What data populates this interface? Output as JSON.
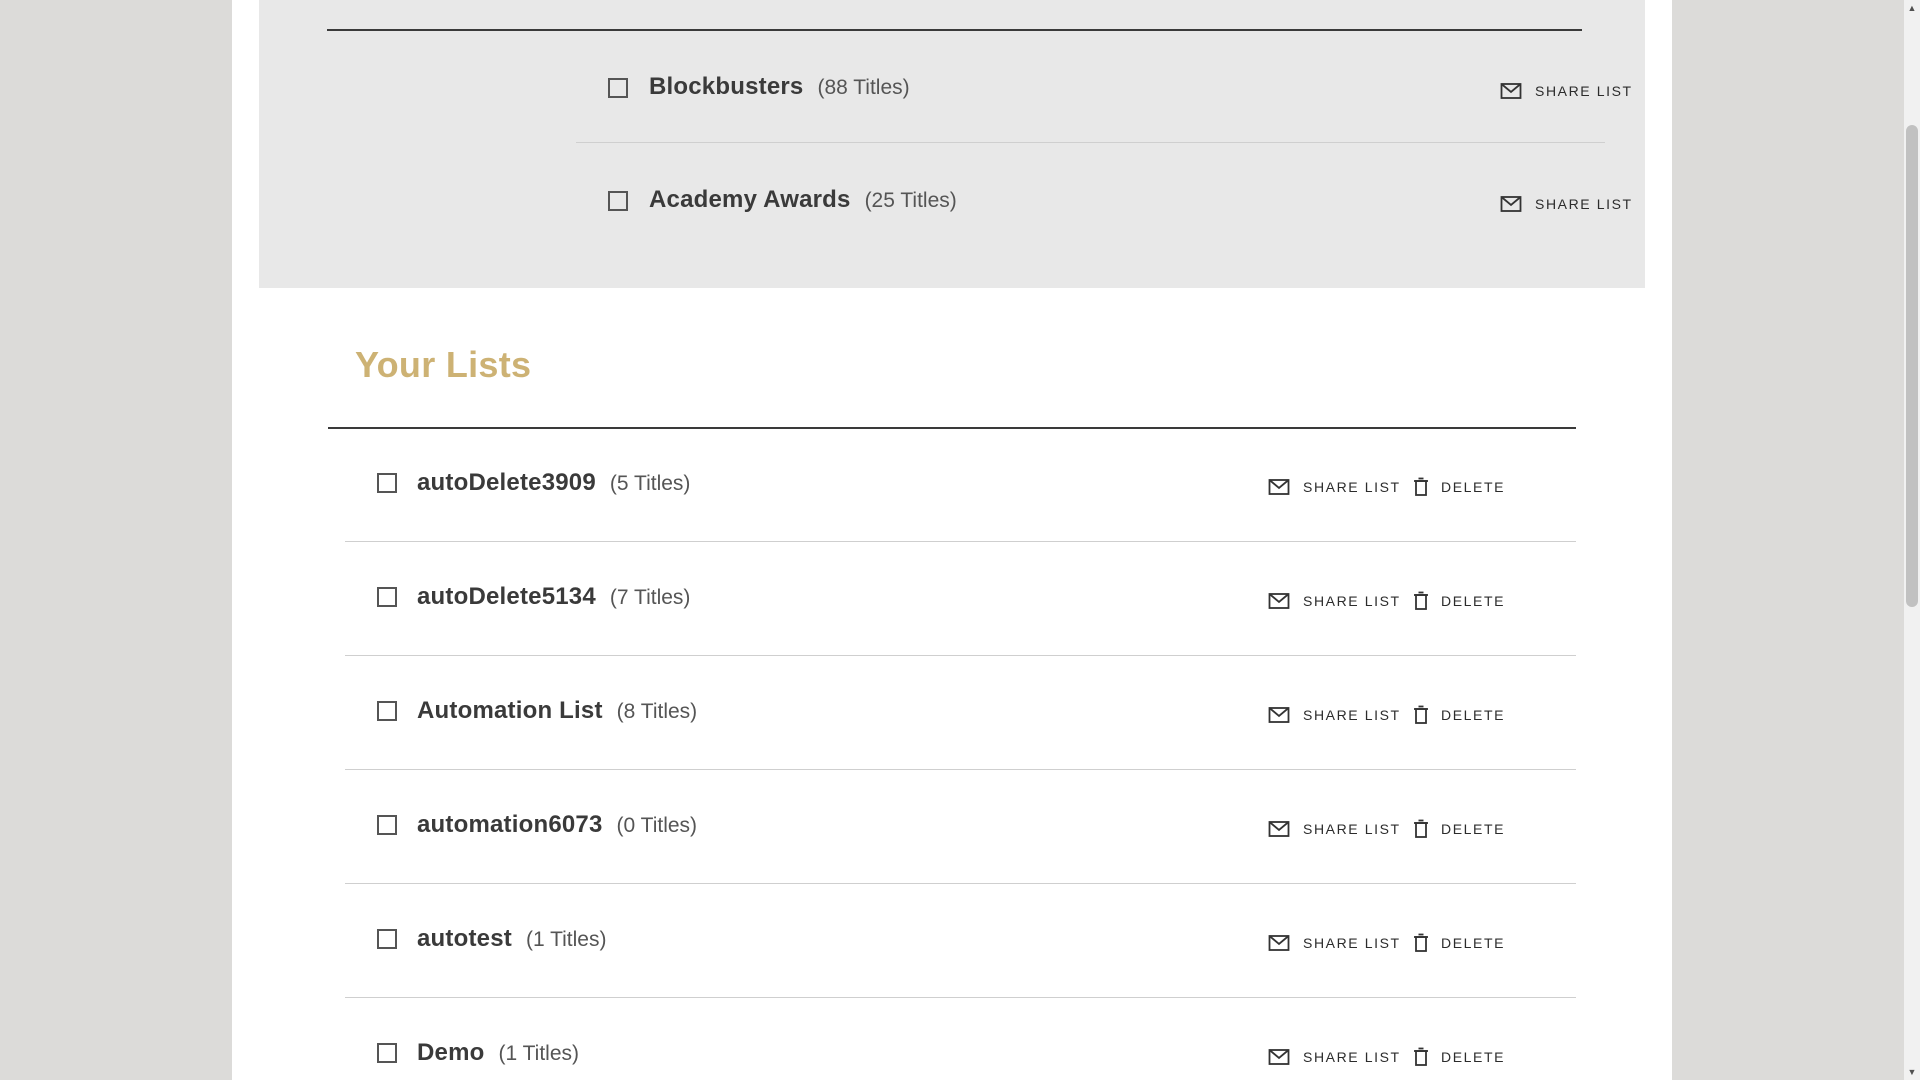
{
  "shared_lists": [
    {
      "name": "Blockbusters",
      "count": "(88 Titles)",
      "share_label": "SHARE LIST"
    },
    {
      "name": "Academy Awards",
      "count": "(25 Titles)",
      "share_label": "SHARE LIST"
    }
  ],
  "your_lists": {
    "title": "Your Lists",
    "items": [
      {
        "name": "autoDelete3909",
        "count": "(5 Titles)",
        "share_label": "SHARE LIST",
        "delete_label": "DELETE"
      },
      {
        "name": "autoDelete5134",
        "count": "(7 Titles)",
        "share_label": "SHARE LIST",
        "delete_label": "DELETE"
      },
      {
        "name": "Automation List",
        "count": "(8 Titles)",
        "share_label": "SHARE LIST",
        "delete_label": "DELETE"
      },
      {
        "name": "automation6073",
        "count": "(0 Titles)",
        "share_label": "SHARE LIST",
        "delete_label": "DELETE"
      },
      {
        "name": "autotest",
        "count": "(1 Titles)",
        "share_label": "SHARE LIST",
        "delete_label": "DELETE"
      },
      {
        "name": "Demo",
        "count": "(1 Titles)",
        "share_label": "SHARE LIST",
        "delete_label": "DELETE"
      }
    ]
  },
  "icons": {
    "share": "mail-icon",
    "delete": "trash-icon",
    "scroll_up": "arrow-up-icon",
    "scroll_down": "arrow-down-icon"
  },
  "colors": {
    "accent": "#cdb274",
    "shared_bg": "#e8e8e8",
    "page_bg": "#dcdbd9",
    "text": "#3a3a3a"
  }
}
